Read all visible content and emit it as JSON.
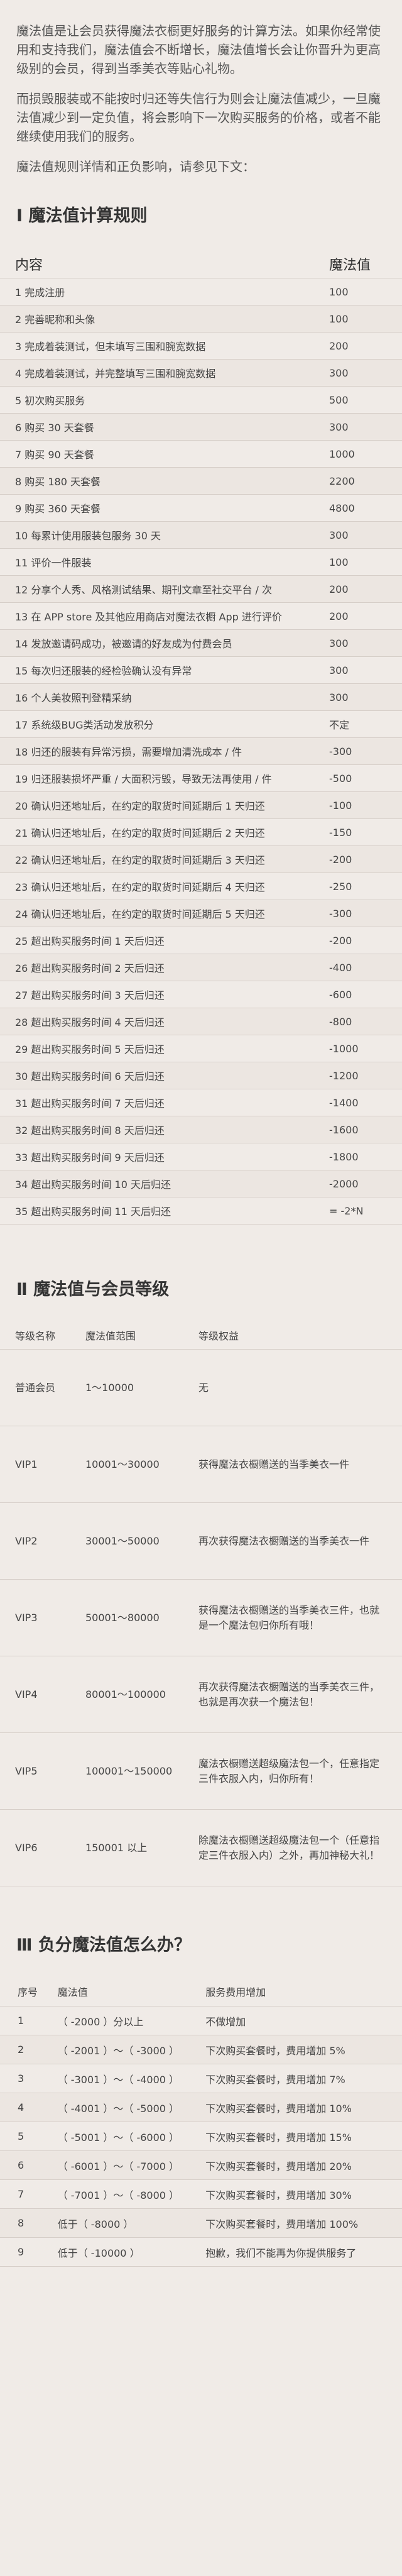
{
  "intro": {
    "p1": "魔法值是让会员获得魔法衣橱更好服务的计算方法。如果你经常使用和支持我们，魔法值会不断增长，魔法值增长会让你晋升为更高级别的会员，得到当季美衣等贴心礼物。",
    "p2": "而损毁服装或不能按时归还等失信行为则会让魔法值减少，一旦魔法值减少到一定负值，将会影响下一次购买服务的价格，或者不能继续使用我们的服务。",
    "p3": "魔法值规则详情和正负影响，请参见下文："
  },
  "section1": {
    "title": "Ⅰ 魔法值计算规则",
    "headers": [
      "内容",
      "魔法值"
    ],
    "rows": [
      [
        "1 完成注册",
        "100"
      ],
      [
        "2 完善昵称和头像",
        "100"
      ],
      [
        "3 完成着装测试，但未填写三围和腕宽数据",
        "200"
      ],
      [
        "4 完成着装测试，并完整填写三围和腕宽数据",
        "300"
      ],
      [
        "5 初次购买服务",
        "500"
      ],
      [
        "6 购买 30 天套餐",
        "300"
      ],
      [
        "7 购买 90 天套餐",
        "1000"
      ],
      [
        "8 购买 180 天套餐",
        "2200"
      ],
      [
        "9 购买 360 天套餐",
        "4800"
      ],
      [
        "10 每累计使用服装包服务 30 天",
        "300"
      ],
      [
        "11 评价一件服装",
        "100"
      ],
      [
        "12 分享个人秀、风格测试结果、期刊文章至社交平台 / 次",
        "200"
      ],
      [
        "13 在 APP store 及其他应用商店对魔法衣橱 App 进行评价",
        "200"
      ],
      [
        "14 发放邀请码成功，被邀请的好友成为付费会员",
        "300"
      ],
      [
        "15 每次归还服装的经检验确认没有异常",
        "300"
      ],
      [
        "16 个人美妆照刊登精采纳",
        "300"
      ],
      [
        "17 系统级BUG类活动发放积分",
        "不定"
      ],
      [
        "18 归还的服装有异常污损，需要增加清洗成本 / 件",
        "-300"
      ],
      [
        "19 归还服装损坏严重 / 大面积污毁，导致无法再使用 / 件",
        "-500"
      ],
      [
        "20 确认归还地址后，在约定的取货时间延期后 1 天归还",
        "-100"
      ],
      [
        "21 确认归还地址后，在约定的取货时间延期后 2 天归还",
        "-150"
      ],
      [
        "22 确认归还地址后，在约定的取货时间延期后 3 天归还",
        "-200"
      ],
      [
        "23 确认归还地址后，在约定的取货时间延期后 4 天归还",
        "-250"
      ],
      [
        "24 确认归还地址后，在约定的取货时间延期后 5 天归还",
        "-300"
      ],
      [
        "25 超出购买服务时间 1 天后归还",
        "-200"
      ],
      [
        "26 超出购买服务时间 2 天后归还",
        "-400"
      ],
      [
        "27 超出购买服务时间 3 天后归还",
        "-600"
      ],
      [
        "28 超出购买服务时间 4 天后归还",
        "-800"
      ],
      [
        "29 超出购买服务时间 5 天后归还",
        "-1000"
      ],
      [
        "30 超出购买服务时间 6 天后归还",
        "-1200"
      ],
      [
        "31 超出购买服务时间 7 天后归还",
        "-1400"
      ],
      [
        "32 超出购买服务时间 8 天后归还",
        "-1600"
      ],
      [
        "33 超出购买服务时间 9 天后归还",
        "-1800"
      ],
      [
        "34 超出购买服务时间 10 天后归还",
        "-2000"
      ],
      [
        "35 超出购买服务时间 11 天后归还",
        "= -2*N"
      ]
    ]
  },
  "section2": {
    "title": "Ⅱ 魔法值与会员等级",
    "headers": [
      "等级名称",
      "魔法值范围",
      "等级权益"
    ],
    "rows": [
      [
        "普通会员",
        "1～10000",
        "无"
      ],
      [
        "VIP1",
        "10001～30000",
        "获得魔法衣橱赠送的当季美衣一件"
      ],
      [
        "VIP2",
        "30001～50000",
        "再次获得魔法衣橱赠送的当季美衣一件"
      ],
      [
        "VIP3",
        "50001～80000",
        "获得魔法衣橱赠送的当季美衣三件，也就是一个魔法包归你所有哦！"
      ],
      [
        "VIP4",
        "80001～100000",
        "再次获得魔法衣橱赠送的当季美衣三件，也就是再次获一个魔法包！"
      ],
      [
        "VIP5",
        "100001～150000",
        "魔法衣橱赠送超级魔法包一个，任意指定三件衣服入内，归你所有！"
      ],
      [
        "VIP6",
        "150001 以上",
        "除魔法衣橱赠送超级魔法包一个（任意指定三件衣服入内）之外，再加神秘大礼！"
      ]
    ]
  },
  "section3": {
    "title": "Ⅲ 负分魔法值怎么办？",
    "headers": [
      "序号",
      "魔法值",
      "服务费用增加"
    ],
    "rows": [
      [
        "1",
        "（ -2000 ）分以上",
        "不做增加"
      ],
      [
        "2",
        "（ -2001 ）～（ -3000 ）",
        "下次购买套餐时，费用增加 5%"
      ],
      [
        "3",
        "（ -3001 ）～（ -4000 ）",
        "下次购买套餐时，费用增加 7%"
      ],
      [
        "4",
        "（ -4001 ）～（ -5000 ）",
        "下次购买套餐时，费用增加 10%"
      ],
      [
        "5",
        "（ -5001 ）～（ -6000 ）",
        "下次购买套餐时，费用增加 15%"
      ],
      [
        "6",
        "（ -6001 ）～（ -7000 ）",
        "下次购买套餐时，费用增加 20%"
      ],
      [
        "7",
        "（ -7001 ）～（ -8000 ）",
        "下次购买套餐时，费用增加 30%"
      ],
      [
        "8",
        "低于（ -8000 ）",
        "下次购买套餐时，费用增加 100%"
      ],
      [
        "9",
        "低于（ -10000 ）",
        "抱歉，我们不能再为你提供服务了"
      ]
    ]
  }
}
